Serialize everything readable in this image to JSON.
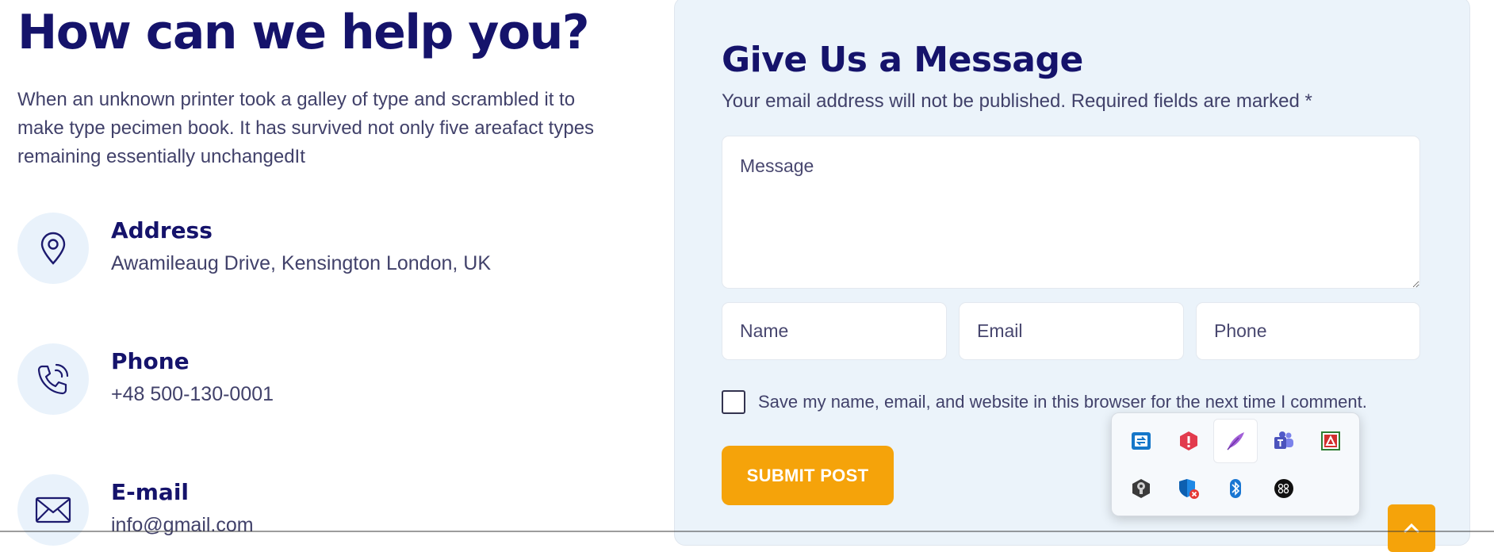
{
  "left": {
    "heading": "How can we help you?",
    "intro": "When an unknown printer took a galley of type and scrambled it to make type pecimen book. It has survived not only five areafact types remaining essentially unchangedIt",
    "contacts": [
      {
        "icon": "map-pin-icon",
        "title": "Address",
        "value": "Awamileaug Drive, Kensington London, UK"
      },
      {
        "icon": "phone-icon",
        "title": "Phone",
        "value": "+48 500-130-0001"
      },
      {
        "icon": "mail-icon",
        "title": "E-mail",
        "value": "info@gmail.com"
      }
    ]
  },
  "form": {
    "title": "Give Us a Message",
    "subtitle": "Your email address will not be published. Required fields are marked *",
    "message_placeholder": "Message",
    "name_placeholder": "Name",
    "email_placeholder": "Email",
    "phone_placeholder": "Phone",
    "remember_label": "Save my name, email, and website in this browser for the next time I comment.",
    "submit_label": "SUBMIT POST"
  },
  "tray": {
    "icons": [
      "sync-app-icon",
      "security-alert-icon",
      "feather-app-icon",
      "teams-icon",
      "pdf-app-icon",
      "keyhole-app-icon",
      "defender-warning-icon",
      "bluetooth-icon",
      "bang-olufsen-icon"
    ]
  },
  "colors": {
    "heading": "#15136b",
    "accent": "#f5a30a",
    "panel": "#ebf3fa",
    "icon_bg": "#e9f2fb"
  }
}
